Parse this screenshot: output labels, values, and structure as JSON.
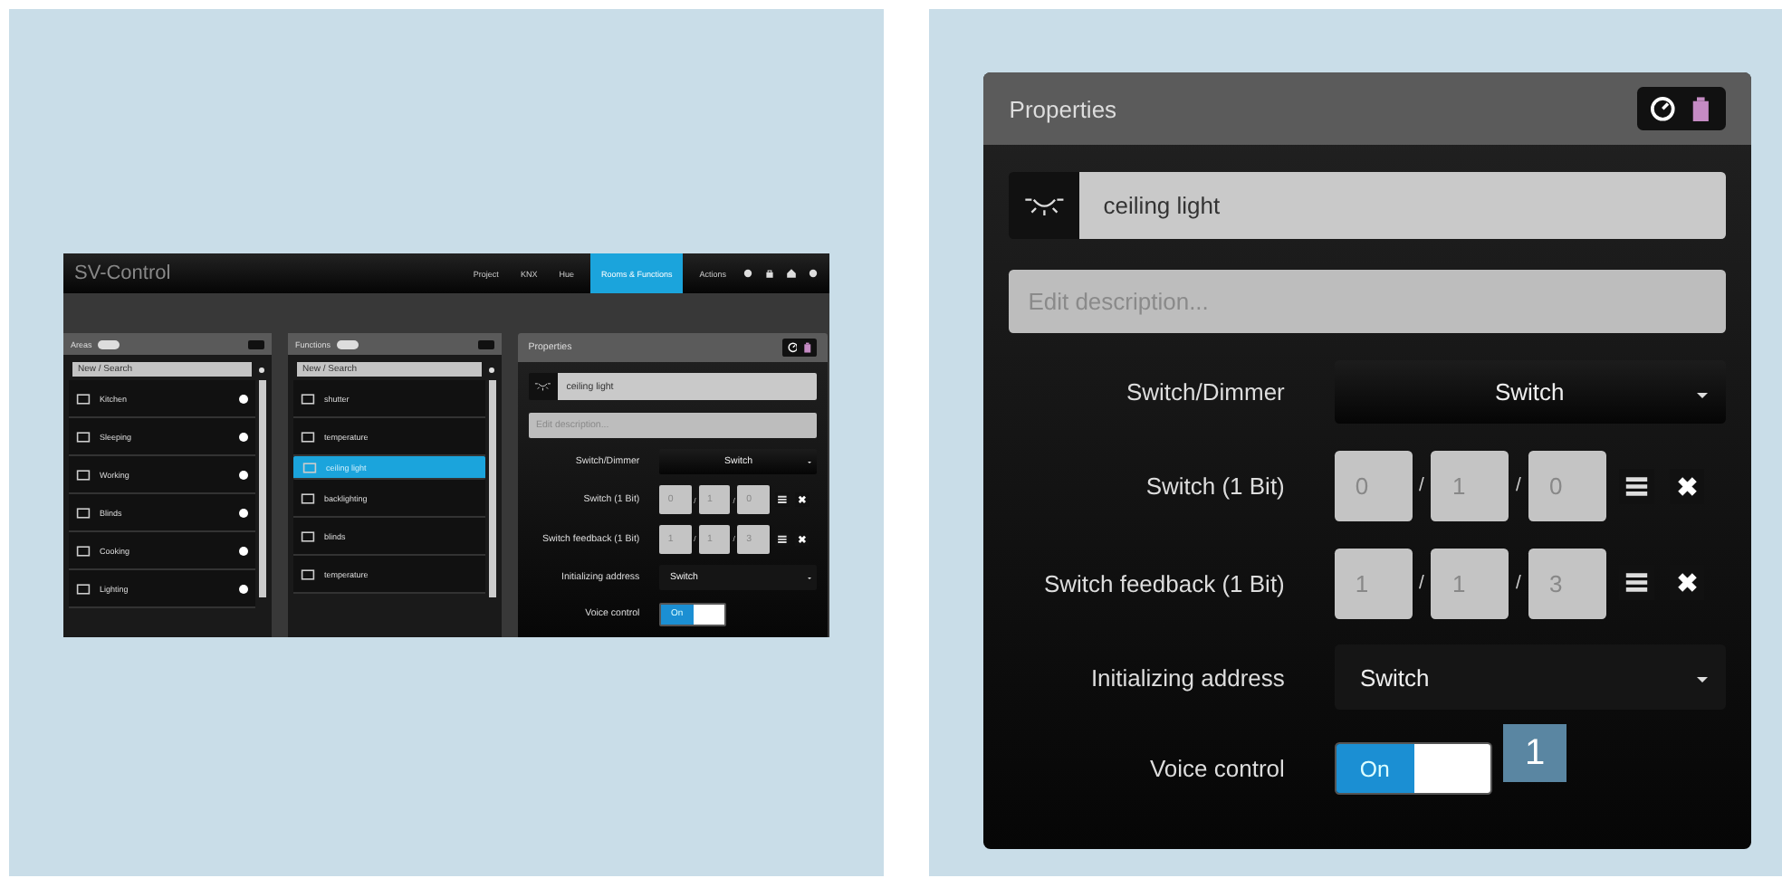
{
  "mini_app": {
    "title": "SV-Control",
    "nav": [
      {
        "label": "Project",
        "selected": false
      },
      {
        "label": "KNX",
        "selected": false
      },
      {
        "label": "Hue",
        "selected": false
      },
      {
        "label": "Rooms & Functions",
        "selected": true
      },
      {
        "label": "Actions",
        "selected": false
      }
    ],
    "areas": {
      "title": "Areas",
      "search": {
        "placeholder": "New / Search"
      },
      "items": [
        {
          "label": "Kitchen"
        },
        {
          "label": "Sleeping"
        },
        {
          "label": "Working"
        },
        {
          "label": "Blinds"
        },
        {
          "label": "Cooking"
        },
        {
          "label": "Lighting"
        }
      ]
    },
    "functions": {
      "title": "Functions",
      "search": {
        "placeholder": "New / Search"
      },
      "items": [
        {
          "label": "shutter",
          "selected": false
        },
        {
          "label": "temperature",
          "selected": false
        },
        {
          "label": "ceiling light",
          "selected": true
        },
        {
          "label": "backlighting",
          "selected": false
        },
        {
          "label": "blinds",
          "selected": false
        },
        {
          "label": "temperature",
          "selected": false
        }
      ]
    },
    "properties": {
      "title": "Properties",
      "name": "ceiling light",
      "description": {
        "placeholder": "Edit description..."
      },
      "rows": [
        {
          "kind": "dropdown",
          "label": "Switch/Dimmer",
          "value": "Switch"
        },
        {
          "kind": "address",
          "label": "Switch (1 Bit)",
          "parts": [
            "0",
            "1",
            "0"
          ],
          "separator": "/"
        },
        {
          "kind": "address",
          "label": "Switch feedback (1 Bit)",
          "parts": [
            "1",
            "1",
            "3"
          ],
          "separator": "/"
        },
        {
          "kind": "select",
          "label": "Initializing address",
          "value": "Switch"
        },
        {
          "kind": "toggle",
          "label": "Voice control",
          "value": "On",
          "on": true
        }
      ]
    }
  },
  "properties_panel": {
    "title": "Properties",
    "name": "ceiling light",
    "description": {
      "placeholder": "Edit description..."
    },
    "rows": [
      {
        "kind": "dropdown",
        "label": "Switch/Dimmer",
        "value": "Switch"
      },
      {
        "kind": "address",
        "label": "Switch (1 Bit)",
        "parts": [
          "0",
          "1",
          "0"
        ],
        "separator": "/"
      },
      {
        "kind": "address",
        "label": "Switch feedback (1 Bit)",
        "parts": [
          "1",
          "1",
          "3"
        ],
        "separator": "/"
      },
      {
        "kind": "select",
        "label": "Initializing address",
        "value": "Switch"
      },
      {
        "kind": "toggle",
        "label": "Voice control",
        "value": "On",
        "on": true
      }
    ]
  },
  "callout": "1"
}
